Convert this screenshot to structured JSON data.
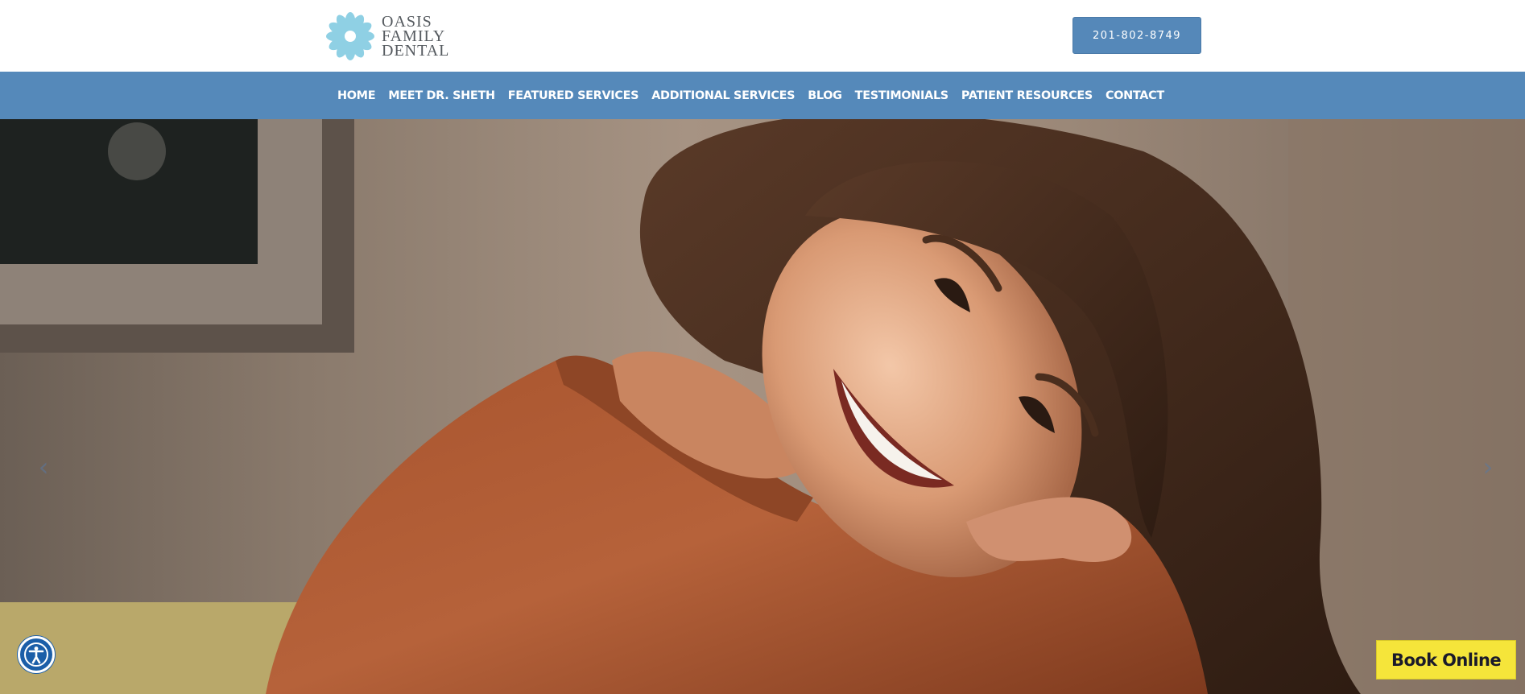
{
  "brand": {
    "logo_line1": "OASIS",
    "logo_line2": "FAMILY",
    "logo_line3": "DENTAL",
    "logo_color": "#7ecbe0",
    "accent": "#5589ba"
  },
  "header": {
    "phone_label": "201-802-8749"
  },
  "nav": {
    "items": [
      {
        "label": "HOME"
      },
      {
        "label": "MEET DR. SHETH"
      },
      {
        "label": "FEATURED SERVICES"
      },
      {
        "label": "ADDITIONAL SERVICES"
      },
      {
        "label": "BLOG"
      },
      {
        "label": "TESTIMONIALS"
      },
      {
        "label": "PATIENT RESOURCES"
      },
      {
        "label": "CONTACT"
      }
    ]
  },
  "hero": {
    "prev_icon": "‹",
    "next_icon": "›",
    "image_subject": "smiling-woman-photo"
  },
  "widgets": {
    "accessibility_icon": "accessibility-icon",
    "book_label": "Book Online",
    "book_color": "#f5e53a"
  }
}
